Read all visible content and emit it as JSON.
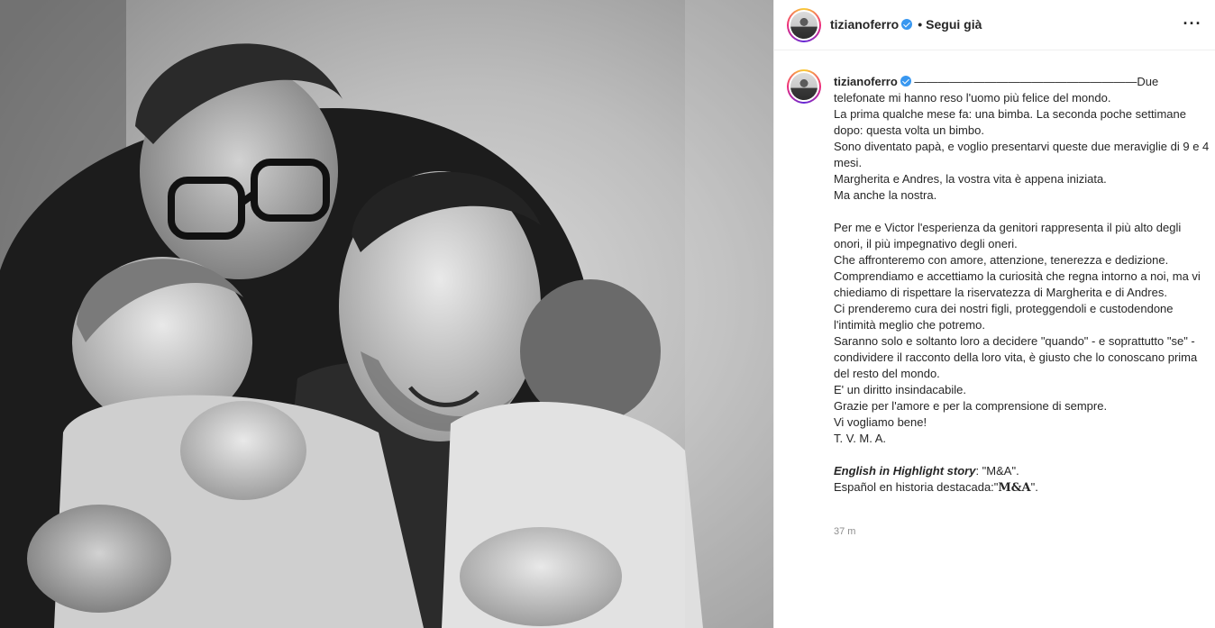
{
  "post": {
    "username": "tizianoferro",
    "follow_status": "Segui già",
    "separator": "•",
    "more_icon": "more-horizontal-icon",
    "verified_icon": "verified-badge-icon"
  },
  "caption": {
    "username": "tizianoferro",
    "first_line": "———————————————————Due telefonate mi hanno reso l'uomo più felice del mondo.",
    "lines_a": [
      "La prima qualche mese fa: una bimba. La seconda poche settimane dopo: questa volta un bimbo.",
      "Sono diventato papà, e voglio presentarvi queste due meraviglie di 9 e 4 mesi.",
      "Margherita e Andres, la vostra vita è appena iniziata.",
      "Ma anche la nostra."
    ],
    "lines_b": [
      "Per me e Victor l'esperienza da genitori rappresenta il più alto degli onori, il più impegnativo degli oneri.",
      "Che affronteremo con amore, attenzione, tenerezza e dedizione.",
      "Comprendiamo e accettiamo la curiosità che regna intorno a noi, ma vi chiediamo di rispettare la riservatezza di Margherita e di Andres.",
      "Ci prenderemo cura dei nostri figli, proteggendoli e custodendone l'intimità meglio che potremo.",
      "Saranno solo e soltanto loro a decidere \"quando\" - e soprattutto \"se\" - condividere il racconto della loro vita, è giusto che lo conoscano prima del resto del mondo.",
      "E' un diritto insindacabile.",
      "Grazie per l'amore e per la comprensione di sempre.",
      "Vi vogliamo bene!",
      "T. V. M. A."
    ],
    "english_label": "English in Highlight story",
    "english_value": ": \"M&A\".",
    "spanish_label": "Español en historia destacada:\"",
    "spanish_value": "M&A",
    "spanish_end": "\".",
    "timestamp": "37 m"
  }
}
